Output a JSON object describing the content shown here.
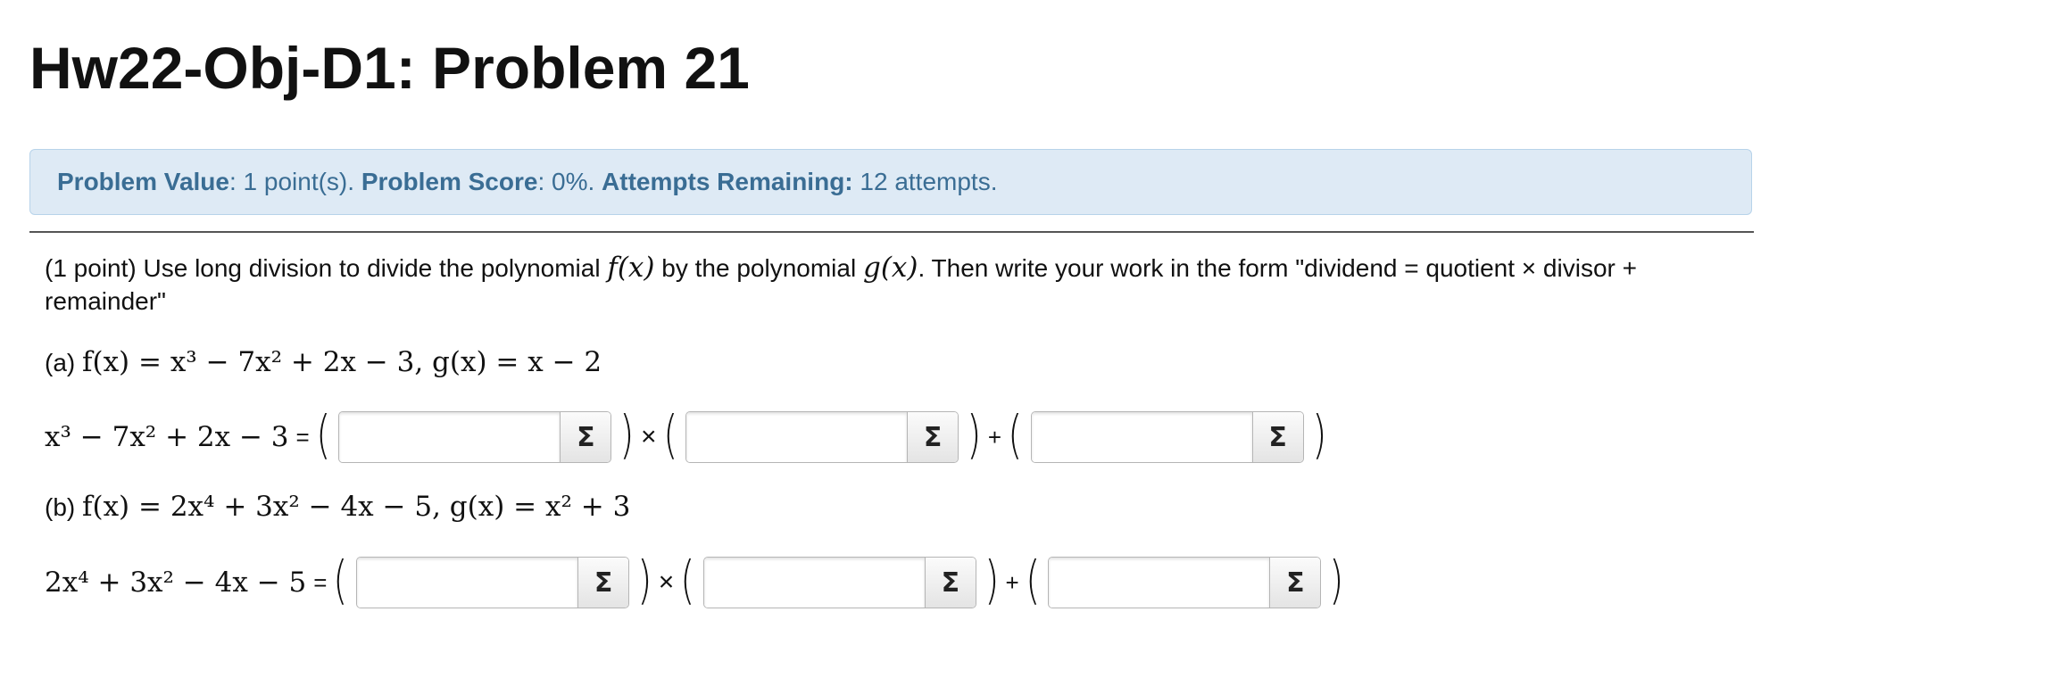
{
  "page": {
    "title": "Hw22-Obj-D1: Problem 21"
  },
  "info": {
    "value_label": "Problem Value",
    "value_text": ": 1 point(s). ",
    "score_label": "Problem Score",
    "score_text": ": 0%. ",
    "attempts_label": "Attempts Remaining:",
    "attempts_text": " 12 attempts."
  },
  "problem": {
    "intro_1": "(1 point) Use long division to divide the polynomial ",
    "intro_fx": "f(x)",
    "intro_2": " by the polynomial ",
    "intro_gx": "g(x)",
    "intro_3": ". Then write your work in the form \"dividend = quotient × divisor +",
    "intro_4": "remainder\"",
    "part_a": {
      "label": "(a) ",
      "statement": "f(x) = x³ − 7x² + 2x − 3,  g(x) = x − 2",
      "lhs": "x³ − 7x² + 2x − 3",
      "equals": "=",
      "times": "×",
      "plus": "+"
    },
    "part_b": {
      "label": "(b) ",
      "statement": "f(x) = 2x⁴ + 3x² − 4x − 5,  g(x) = x² + 3",
      "lhs": "2x⁴ + 3x² − 4x − 5",
      "equals": "=",
      "times": "×",
      "plus": "+"
    }
  },
  "inputs": {
    "a_quotient": "",
    "a_divisor": "",
    "a_remainder": "",
    "b_quotient": "",
    "b_divisor": "",
    "b_remainder": ""
  },
  "icons": {
    "equation_editor": "sigma-icon",
    "equation_editor_glyph": "Σ"
  }
}
